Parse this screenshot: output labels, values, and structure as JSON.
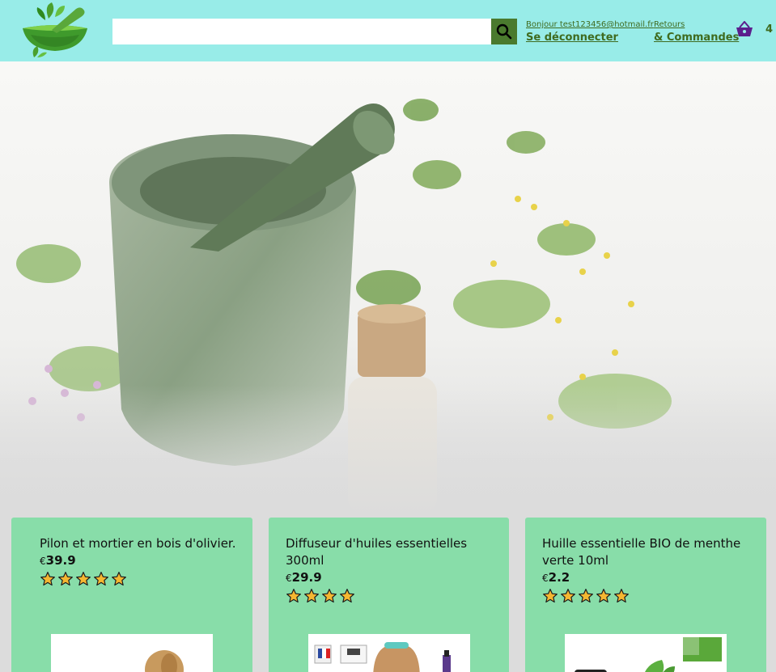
{
  "header": {
    "search": {
      "value": "",
      "placeholder": ""
    },
    "account": {
      "greeting": "Bonjour test123456@hotmail.fr",
      "logout": "Se déconnecter"
    },
    "orders": {
      "returns": "Retours",
      "orders": "& Commandes"
    },
    "cart": {
      "count": "4"
    }
  },
  "products": [
    {
      "title": "Pilon et mortier en bois d'olivier.",
      "currency": "€",
      "price": "39.9",
      "rating": 5
    },
    {
      "title": "Diffuseur d'huiles essentielles 300ml",
      "currency": "€",
      "price": "29.9",
      "rating": 4
    },
    {
      "title": "Huille essentielle BIO de menthe verte 10ml",
      "currency": "€",
      "price": "2.2",
      "rating": 5
    }
  ],
  "colors": {
    "header_bg": "#98ece8",
    "accent_green": "#3f6b1f",
    "card_bg": "#88dda9",
    "cart_purple": "#5b1f8c",
    "star": "#f5b731"
  },
  "icons": {
    "search": "search-icon",
    "cart": "basket-icon",
    "logo": "mortar-leaf-logo",
    "star": "star-icon"
  }
}
